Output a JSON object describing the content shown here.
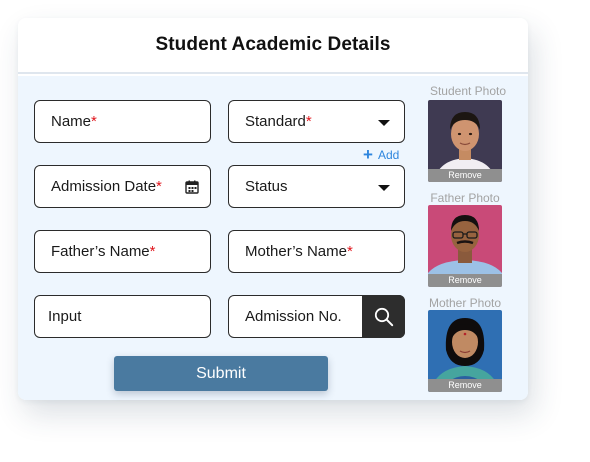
{
  "form": {
    "title": "Student Academic Details",
    "name_label": "Name",
    "standard_label": "Standard",
    "add_label": "Add",
    "admission_date_label": "Admission Date",
    "status_label": "Status",
    "father_name_label": "Father’s Name",
    "mother_name_label": "Mother’s Name",
    "input_placeholder": "Input",
    "admission_no_placeholder": "Admission No.",
    "required_mark": "*",
    "submit_label": "Submit"
  },
  "photos": {
    "student_label": "Student Photo",
    "father_label": "Father Photo",
    "mother_label": "Mother Photo",
    "remove_label": "Remove"
  },
  "icons": {
    "calendar": "calendar-icon",
    "dropdown": "chevron-down-icon",
    "search": "search-icon",
    "add": "plus-icon"
  },
  "colors": {
    "required": "#e0151c",
    "submit_bg": "#4a7aa0",
    "body_bg": "#eef6fe",
    "link": "#2e86de"
  }
}
